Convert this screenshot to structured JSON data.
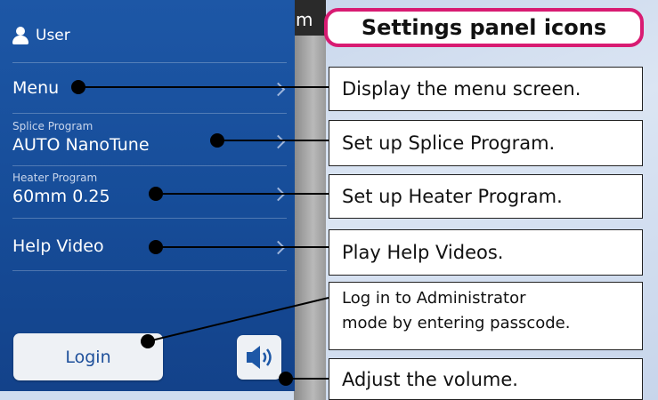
{
  "background": {
    "partial_text": "m"
  },
  "panel": {
    "user_label": "User",
    "items": [
      {
        "title": "Menu",
        "subtitle": ""
      },
      {
        "title": "AUTO NanoTune",
        "subtitle": "Splice Program"
      },
      {
        "title": "60mm 0.25",
        "subtitle": "Heater Program"
      },
      {
        "title": "Help Video",
        "subtitle": ""
      }
    ],
    "login_label": "Login",
    "volume_icon": "speaker-volume-icon"
  },
  "callouts": {
    "title": "Settings panel icons",
    "menu": "Display the menu screen.",
    "splice": "Set up Splice Program.",
    "heater": "Set up Heater Program.",
    "help": "Play Help Videos.",
    "login_line1": "Log in to Administrator",
    "login_line2": "mode by entering passcode.",
    "volume": "Adjust the volume."
  },
  "colors": {
    "panel_blue": "#1d57a6",
    "title_border": "#d81b72",
    "button_bg": "#eef1f5"
  }
}
